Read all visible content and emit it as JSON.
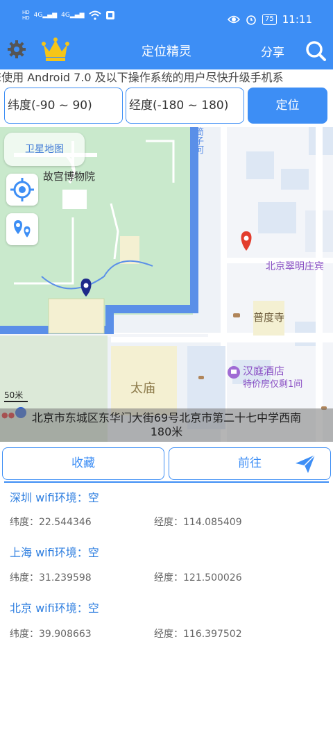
{
  "status_bar": {
    "sig1_label": "4G",
    "sig2_label": "4G",
    "battery": "75",
    "time": "11:11"
  },
  "toolbar": {
    "title": "定位精灵",
    "share_label": "分享"
  },
  "notice": "E使用 Android 7.0 及以下操作系统的用户尽快升级手机系",
  "inputs": {
    "latitude_placeholder": "纬度(-90 ~ 90)",
    "longitude_placeholder": "经度(-180 ~ 180)"
  },
  "locate_label": "定位",
  "map": {
    "satellite_label": "卫星地图",
    "labels": {
      "forbidden_city": "故宫博物院",
      "taimiao": "太庙",
      "pudu_temple": "普度寺",
      "hanting_hotel": "汉庭酒店",
      "hotel_promo": "特价房仅剩1间",
      "cuiming": "北京翠明庄宾",
      "river": "筒子河"
    },
    "scale": "50米",
    "address": "北京市东城区东华门大街69号北京市第二十七中学西南",
    "distance": "180米"
  },
  "favorite_label": "收藏",
  "goto_label": "前往",
  "presets": [
    {
      "title": "深圳 wifi环境：空",
      "lat": "纬度：22.544346",
      "lng": "经度：114.085409"
    },
    {
      "title": "上海 wifi环境：空",
      "lat": "纬度：31.239598",
      "lng": "经度：121.500026"
    },
    {
      "title": "北京 wifi环境：空",
      "lat": "纬度：39.908663",
      "lng": "经度：116.397502"
    }
  ],
  "colors": {
    "accent": "#3d8ef5",
    "preset_title": "#2f7fe0",
    "map_green": "#cdebd0",
    "map_water": "#5a8fe8"
  }
}
